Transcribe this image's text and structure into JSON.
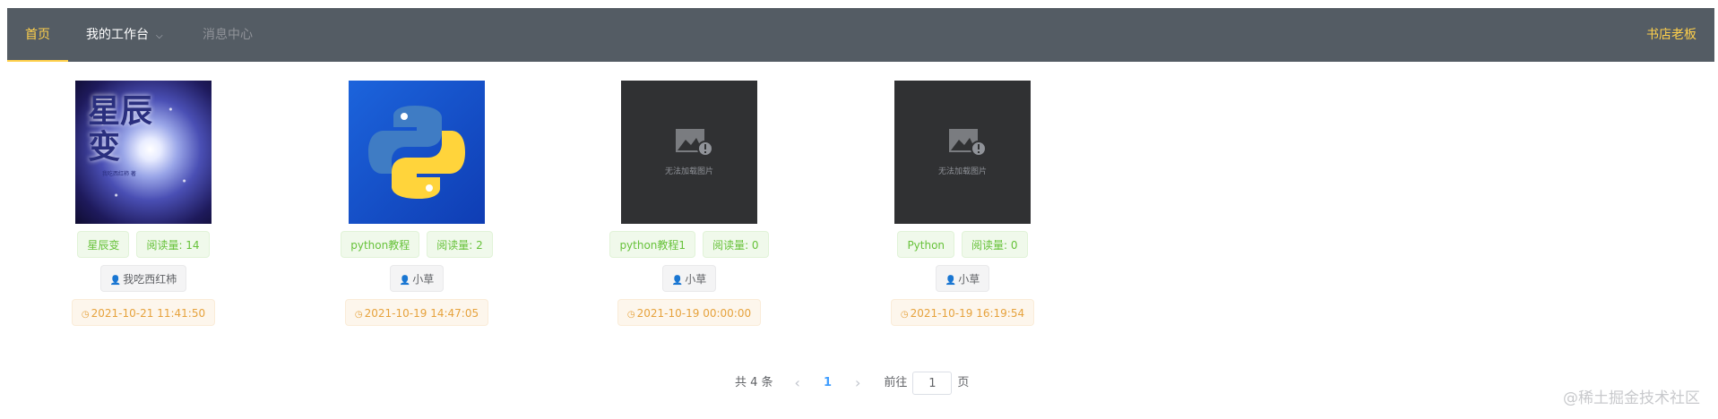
{
  "navbar": {
    "home_label": "首页",
    "workbench_label": "我的工作台",
    "messages_label": "消息中心",
    "user_label": "书店老板",
    "colors": {
      "background": "#545c64",
      "active": "#ffd04b"
    }
  },
  "books": [
    {
      "cover_type": "galaxy",
      "cover_title": "星辰变",
      "cover_footer": "我吃西红柿 著",
      "name": "星辰变",
      "read_count": "阅读量: 14",
      "author": "我吃西红柿",
      "time": "2021-10-21 11:41:50"
    },
    {
      "cover_type": "python-logo",
      "name": "python教程",
      "read_count": "阅读量: 2",
      "author": "小草",
      "time": "2021-10-19 14:47:05"
    },
    {
      "cover_type": "broken-image",
      "cover_error": "无法加载图片",
      "name": "python教程1",
      "read_count": "阅读量: 0",
      "author": "小草",
      "time": "2021-10-19 00:00:00"
    },
    {
      "cover_type": "broken-image",
      "cover_error": "无法加载图片",
      "name": "Python",
      "read_count": "阅读量: 0",
      "author": "小草",
      "time": "2021-10-19 16:19:54"
    }
  ],
  "pagination": {
    "total": "共 4 条",
    "current_page": "1",
    "goto_label": "前往",
    "goto_value": "1",
    "page_suffix": "页"
  },
  "watermark": "@稀土掘金技术社区",
  "icons": {
    "author": "user-icon",
    "time": "clock-icon",
    "broken": "broken-image-icon"
  }
}
